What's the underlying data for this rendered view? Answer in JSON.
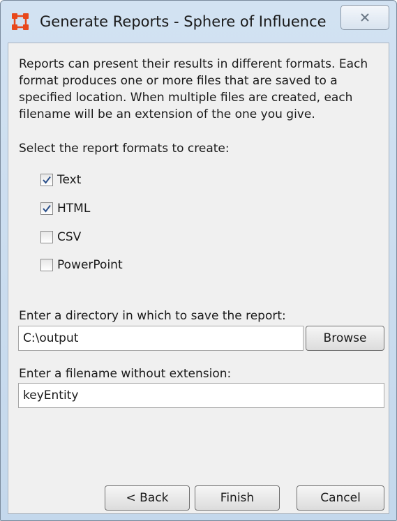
{
  "window": {
    "title": "Generate Reports - Sphere of Influence",
    "close_glyph": "✕"
  },
  "description": "Reports can present their results in different formats. Each format produces one or more files that are saved to a specified location. When multiple files are created, each filename will be an extension of the one you give.",
  "formats": {
    "label": "Select the report formats to create:",
    "options": [
      {
        "label": "Text",
        "checked": true
      },
      {
        "label": "HTML",
        "checked": true
      },
      {
        "label": "CSV",
        "checked": false
      },
      {
        "label": "PowerPoint",
        "checked": false
      }
    ]
  },
  "directory": {
    "label": "Enter a directory in which to save the report:",
    "value": "C:\\output",
    "browse_label": "Browse"
  },
  "filename": {
    "label": "Enter a filename without extension:",
    "value": "keyEntity"
  },
  "buttons": {
    "back": "< Back",
    "finish": "Finish",
    "cancel": "Cancel"
  },
  "colors": {
    "app_icon": "#e8481c",
    "check_mark": "#2a4f8a"
  }
}
